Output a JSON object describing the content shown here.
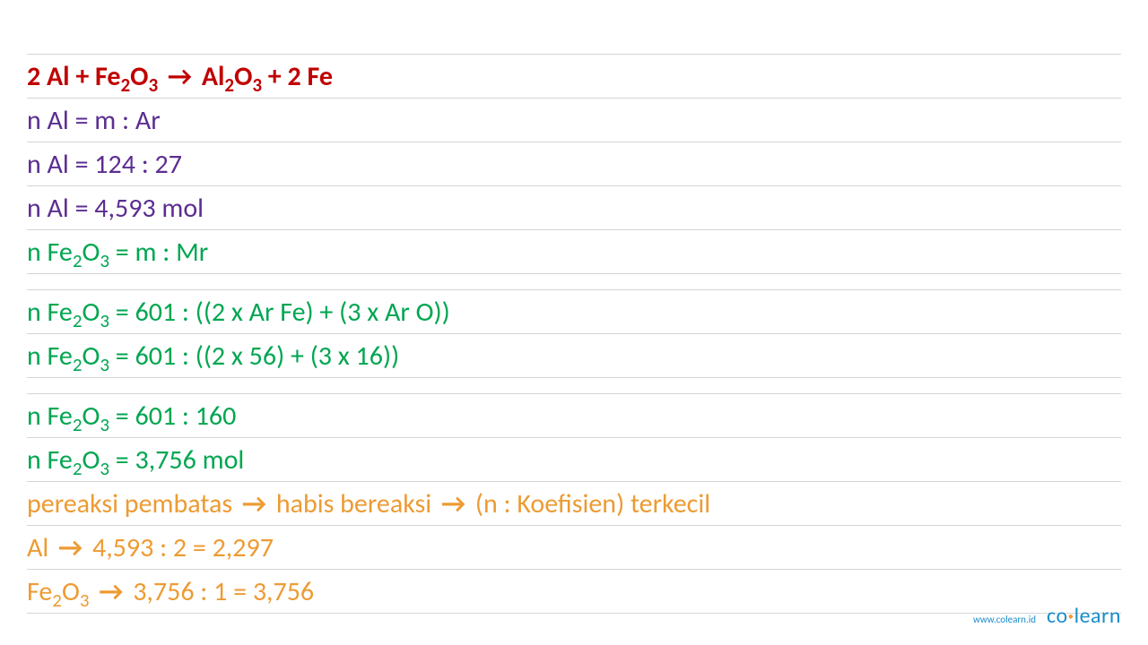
{
  "lines": {
    "l1": {
      "pre": "2 Al + Fe",
      "sub1": "2",
      "mid1": "O",
      "sub2": "3",
      "mid2": " ",
      "arrow": "→",
      "mid3": " Al",
      "sub3": "2",
      "mid4": "O",
      "sub4": "3",
      "post": " + 2 Fe"
    },
    "l2": "n Al = m : Ar",
    "l3": "n Al = 124 : 27",
    "l4": "n Al = 4,593 mol",
    "l5": {
      "pre": "n Fe",
      "sub1": "2",
      "mid": "O",
      "sub2": "3",
      "post": " = m : Mr"
    },
    "l6": {
      "pre": "n Fe",
      "sub1": "2",
      "mid": "O",
      "sub2": "3",
      "post": " = 601 : ((2 x Ar Fe) + (3 x Ar O))"
    },
    "l7": {
      "pre": "n Fe",
      "sub1": "2",
      "mid": "O",
      "sub2": "3",
      "post": " = 601 : ((2 x 56) + (3 x 16))"
    },
    "l8": {
      "pre": "n Fe",
      "sub1": "2",
      "mid": "O",
      "sub2": "3",
      "post": " = 601 : 160"
    },
    "l9": {
      "pre": "n Fe",
      "sub1": "2",
      "mid": "O",
      "sub2": "3",
      "post": " = 3,756 mol"
    },
    "l10": {
      "p1": "pereaksi pembatas ",
      "a1": "→",
      "p2": " habis bereaksi ",
      "a2": "→",
      "p3": " (n : Koefisien) terkecil"
    },
    "l11": {
      "p1": "Al ",
      "a1": "→",
      "p2": " 4,593 : 2 = 2,297"
    },
    "l12": {
      "pre": "Fe",
      "sub1": "2",
      "mid": "O",
      "sub2": "3",
      "sp": " ",
      "a1": "→",
      "post": " 3,756 : 1 = 3,756"
    }
  },
  "footer": {
    "url": "www.colearn.id",
    "logo_co": "co",
    "logo_dot": "·",
    "logo_learn": "learn"
  }
}
